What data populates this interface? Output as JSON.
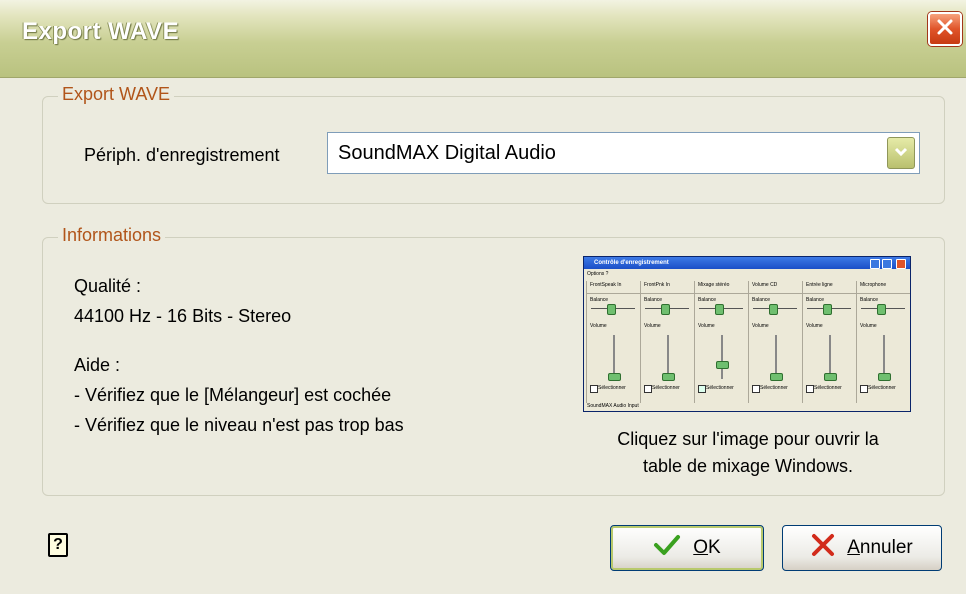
{
  "window": {
    "title": "Export WAVE"
  },
  "export_group": {
    "legend": "Export WAVE",
    "device_label": "Périph. d'enregistrement",
    "device_value": "SoundMAX Digital Audio"
  },
  "info_group": {
    "legend": "Informations",
    "quality_label": "Qualité :",
    "quality_value": "44100 Hz - 16 Bits - Stereo",
    "help_label": "Aide :",
    "help_line1": "- Vérifiez que le [Mélangeur] est cochée",
    "help_line2": "- Vérifiez que le niveau n'est pas trop bas",
    "caption_line1": "Cliquez sur l'image pour ouvrir la",
    "caption_line2": "table de mixage Windows."
  },
  "mixer_thumbnail": {
    "title": "Contrôle d'enregistrement",
    "menu": "Options ?",
    "balance_label": "Balance",
    "volume_label": "Volume",
    "select_label": "Sélectionner",
    "columns": [
      "FrontSpeak In",
      "FrontPnk In",
      "Mixage stéréo",
      "Volume CD",
      "Entrée ligne",
      "Microphone"
    ],
    "status": "SoundMAX Audio Input"
  },
  "buttons": {
    "ok_label": "OK",
    "cancel_label": "Annuler"
  },
  "colors": {
    "accent_legend": "#b1551a",
    "ok_icon": "#3aa11f",
    "cancel_icon": "#d22b1b",
    "close_button": "#e0542a"
  },
  "icons": {
    "close": "close-icon",
    "help": "help-icon",
    "ok": "checkmark-icon",
    "cancel": "x-icon",
    "dropdown": "chevron-down-icon"
  }
}
